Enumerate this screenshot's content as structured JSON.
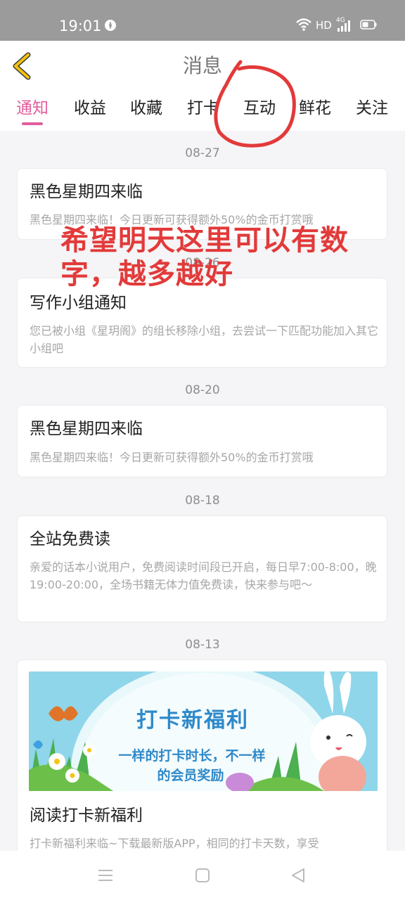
{
  "status_bar": {
    "time": "19:01",
    "hd": "HD",
    "network": "4G",
    "icons": [
      "compass-icon",
      "wifi-icon",
      "signal-icon",
      "battery-icon"
    ]
  },
  "header": {
    "title": "消息",
    "back_icon": "chevron-left-icon",
    "back_color": "#f2c20d"
  },
  "tabs": [
    {
      "label": "通知",
      "active": true
    },
    {
      "label": "收益",
      "active": false
    },
    {
      "label": "收藏",
      "active": false
    },
    {
      "label": "打卡",
      "active": false
    },
    {
      "label": "互动",
      "active": false
    },
    {
      "label": "鲜花",
      "active": false
    },
    {
      "label": "关注",
      "active": false
    }
  ],
  "accent_color": "#e15d9b",
  "messages": [
    {
      "date": "08-27",
      "title": "黑色星期四来临",
      "desc": "黑色星期四来临！今日更新可获得额外50%的金币打赏哦"
    },
    {
      "date": "08-26",
      "title": "写作小组通知",
      "desc": "您已被小组《星玥阁》的组长移除小组，去尝试一下匹配功能加入其它小组吧"
    },
    {
      "date": "08-20",
      "title": "黑色星期四来临",
      "desc": "黑色星期四来临！今日更新可获得额外50%的金币打赏哦"
    },
    {
      "date": "08-18",
      "title": "全站免费读",
      "desc": "亲爱的话本小说用户，免费阅读时间段已开启，每日早7:00-8:00，晚19:00-20:00，全场书籍无体力值免费读，快来参与吧～"
    },
    {
      "date": "08-13",
      "title": "阅读打卡新福利",
      "desc": "打卡新福利来临~下载最新版APP，相同的打卡天数，享受",
      "banner": {
        "headline": "打卡新福利",
        "sub1": "一样的打卡时长，不一样",
        "sub2": "的会员奖励"
      }
    }
  ],
  "annotation": {
    "text": "希望明天这里可以有数字，越多越好",
    "color": "#e23a3a"
  },
  "bottom_nav": {
    "icons": [
      "menu-icon",
      "home-square-icon",
      "back-triangle-icon"
    ]
  }
}
